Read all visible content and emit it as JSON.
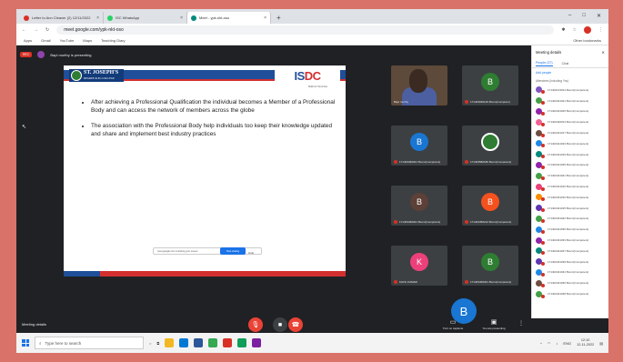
{
  "browser": {
    "tabs": [
      {
        "label": "Letter to Ann Cleaver (2) 12/11/2022"
      },
      {
        "label": "ISC WhatsApp"
      },
      {
        "label": "Meet - ypk-nkt-oso"
      }
    ],
    "url": "meet.google.com/ypk-nkt-oso",
    "bookmarks": [
      "Apps",
      "Gmail",
      "YouTube",
      "Maps",
      "Teaching Diary"
    ],
    "other_bookmarks": "Other bookmarks"
  },
  "meet": {
    "rec_label": "REC",
    "presenting_text": "Bapi murthy is presenting",
    "slide": {
      "left_logo": "ST. JOSEPH'S",
      "left_logo_sub": "DEGREE & PG COLLEGE",
      "right_logo_i": "IS",
      "right_logo_dc": "DC",
      "right_logo_tagline": "Skills for Tomorrow",
      "bullets": [
        "After achieving a Professional Qualification the individual becomes a Member of a Professional Body and can access the network of members across the globe",
        "The association with the Professional Body help individuals too keep their knowledge updated and share and implement best industry practices"
      ],
      "share_notice": "meet.google.com is sharing your screen.",
      "stop_sharing": "Stop sharing",
      "hide": "Hide"
    },
    "tiles": [
      {
        "initial": "",
        "name": "Bapi murthy",
        "color": "#3c4043"
      },
      {
        "initial": "B",
        "name": "171403030129 Bcom(Computer)",
        "color": "#2e7d32"
      },
      {
        "initial": "B",
        "name": "171403460021 Bcom(Computers)",
        "color": "#1976d2"
      },
      {
        "initial": "",
        "name": "171403580180 Bcom(Computers)",
        "color": "#2e7d32"
      },
      {
        "initial": "B",
        "name": "171403460021 Bcom(Computers)",
        "color": "#5d4037"
      },
      {
        "initial": "B",
        "name": "171403450212 Bcom(Computers)",
        "color": "#f4511e"
      },
      {
        "initial": "K",
        "name": "KAVIL KUMAR",
        "color": "#ec407a"
      },
      {
        "initial": "B",
        "name": "171403460021 Bcom(Computers)",
        "color": "#2e7d32"
      }
    ],
    "big_tile_initial": "B",
    "meeting_details": "Meeting details",
    "turn_on_captions": "Turn on captions",
    "you_presenting": "You are presenting"
  },
  "side_panel": {
    "title": "Meeting details",
    "tab_people": "People (37)",
    "tab_chat": "Chat",
    "add_people": "Add people",
    "section": "Attendees (Including You)",
    "participants": [
      {
        "name": "171402123014 Bcom(Computers)",
        "color": "#7e57c2"
      },
      {
        "name": "171402421021 Bcom(Computers)",
        "color": "#43a047"
      },
      {
        "name": "171402431045 Bcom(Computers)",
        "color": "#8e24aa"
      },
      {
        "name": "171402420013 Bcom(Computers)",
        "color": "#f06292"
      },
      {
        "name": "171402431017 Bcom(Computers)",
        "color": "#6d4c41"
      },
      {
        "name": "171402421023 Bcom(Computers)",
        "color": "#1e88e5"
      },
      {
        "name": "171402431019 Bcom(Computers)",
        "color": "#00897b"
      },
      {
        "name": "171402421025 Bcom(Computers)",
        "color": "#8e24aa"
      },
      {
        "name": "171402431041 Bcom(Computers)",
        "color": "#43a047"
      },
      {
        "name": "171402421010 Bcom(Computers)",
        "color": "#ec407a"
      },
      {
        "name": "171402431010 Bcom(Computers)",
        "color": "#fb8c00"
      },
      {
        "name": "171402421015 Bcom(Computers)",
        "color": "#5e35b1"
      },
      {
        "name": "171402431022 Bcom(Computers)",
        "color": "#43a047"
      },
      {
        "name": "171402421030 Bcom(Computers)",
        "color": "#1e88e5"
      },
      {
        "name": "171402431033 Bcom(Computers)",
        "color": "#8e24aa"
      },
      {
        "name": "171402421037 Bcom(Computers)",
        "color": "#00897b"
      },
      {
        "name": "171402431039 Bcom(Computers)",
        "color": "#5e35b1"
      },
      {
        "name": "171402421044 Bcom(Computers)",
        "color": "#1e88e5"
      },
      {
        "name": "171402431046 Bcom(Computers)",
        "color": "#6d4c41"
      },
      {
        "name": "171402421048 Bcom(Computers)",
        "color": "#43a047"
      }
    ]
  },
  "taskbar": {
    "search_placeholder": "Type here to search",
    "time": "12:10",
    "date": "12-11-2022",
    "lang": "ENG"
  }
}
